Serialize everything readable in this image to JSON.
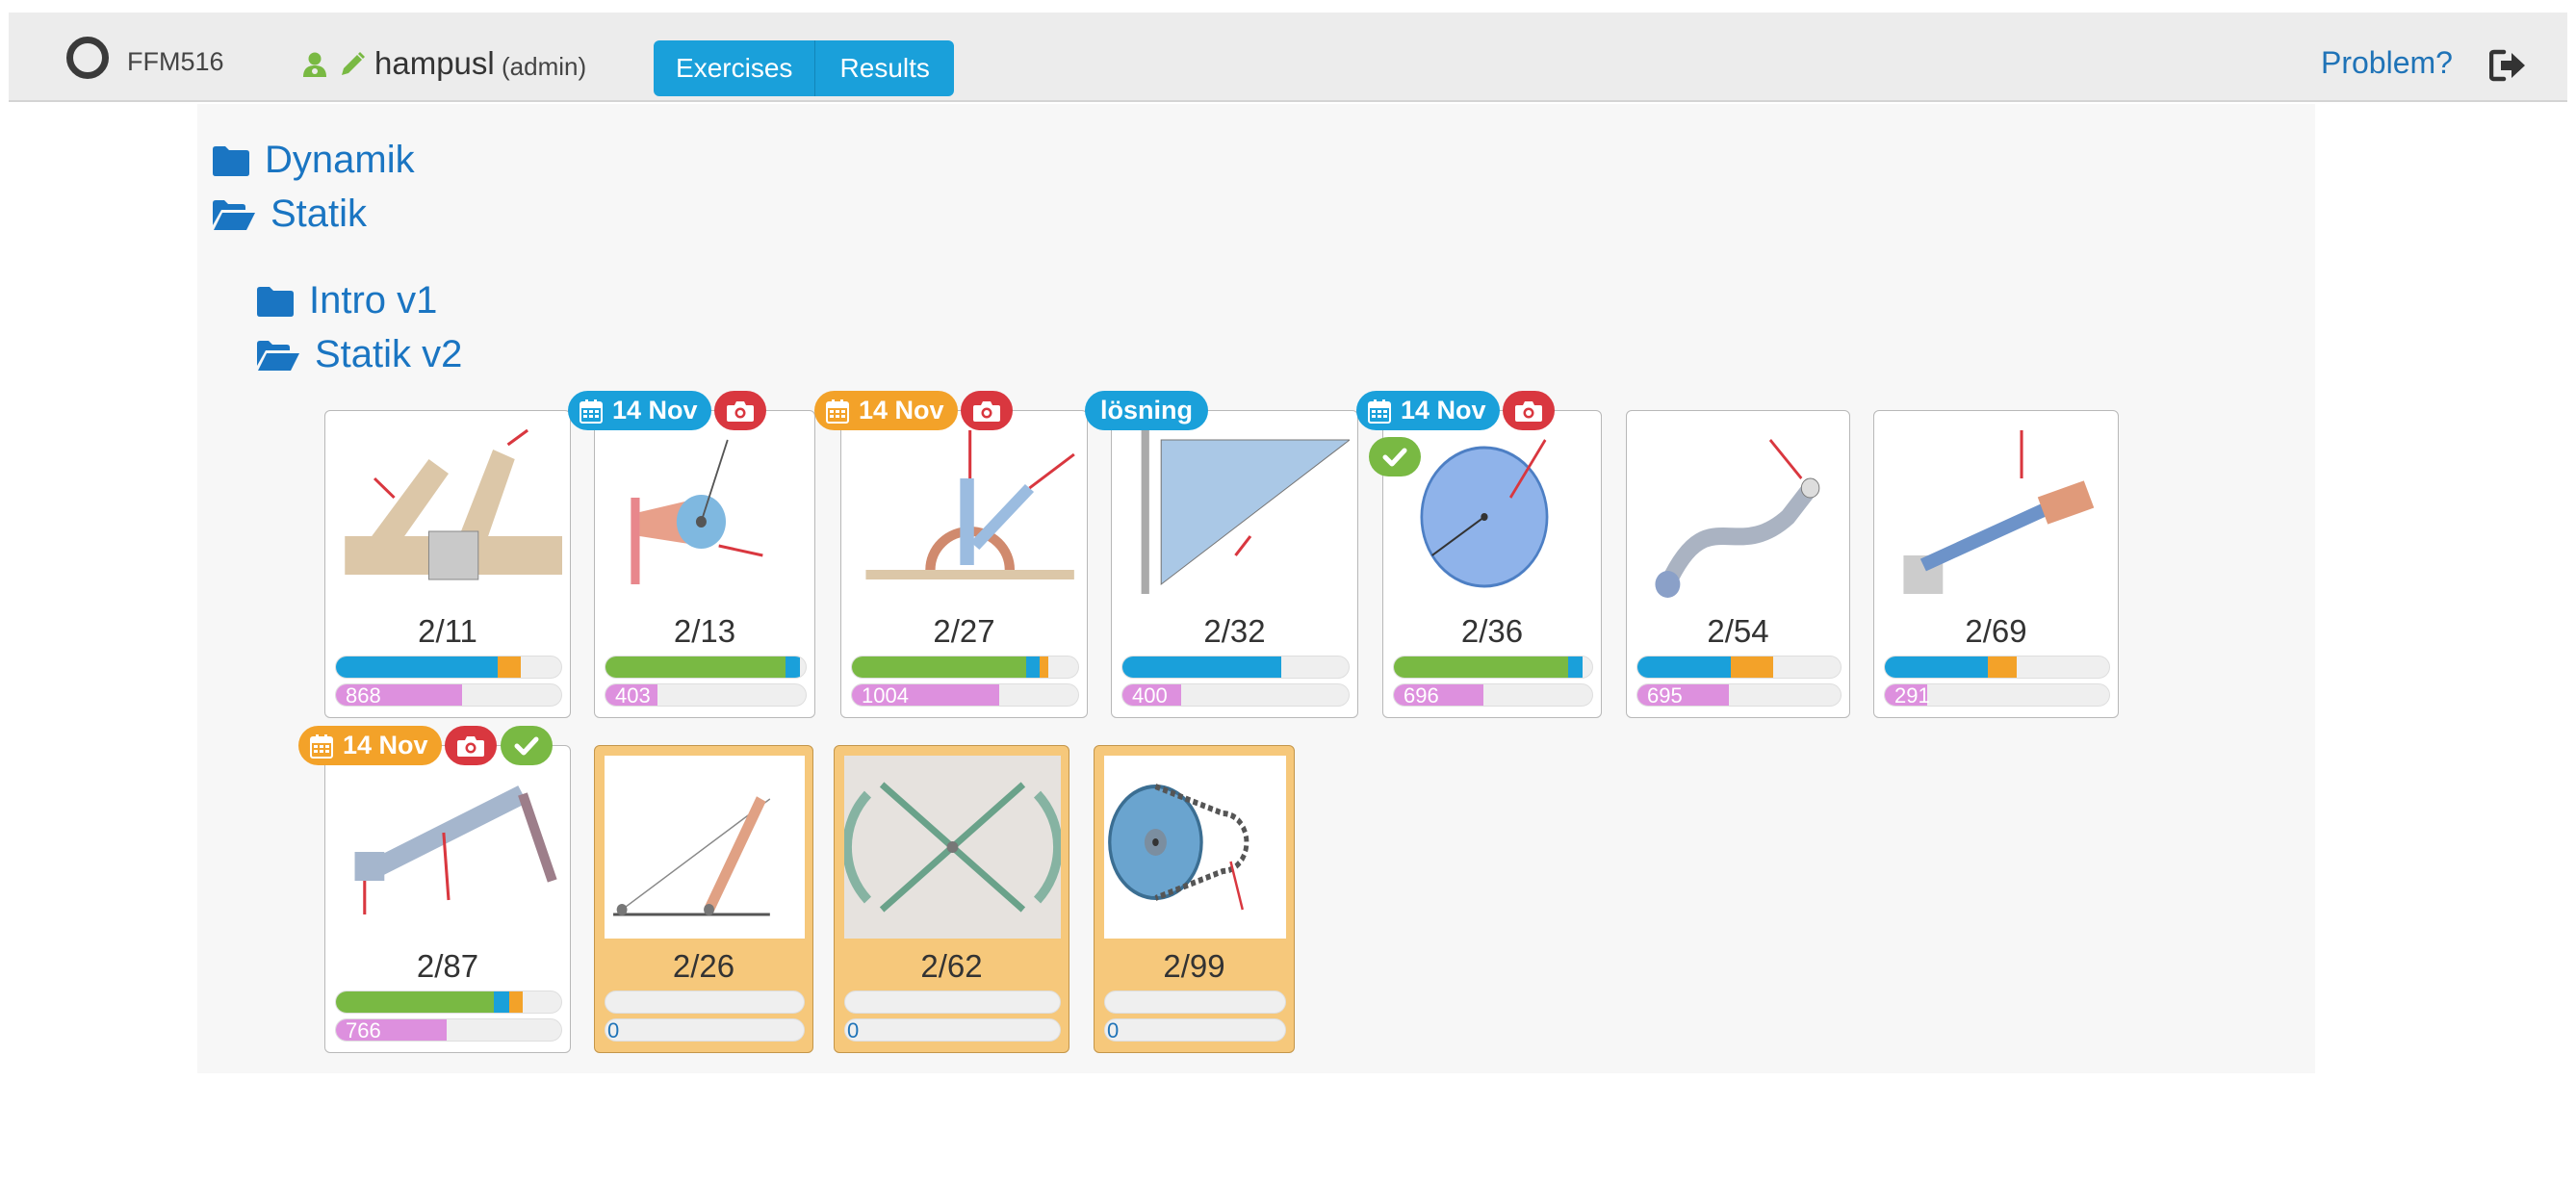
{
  "navbar": {
    "course": "FFM516",
    "username": "hampusl",
    "role": "(admin)",
    "tabs": {
      "exercises": "Exercises",
      "results": "Results"
    },
    "problem_link": "Problem?",
    "icons": [
      "user-icon",
      "pencil-icon",
      "sign-out-icon"
    ]
  },
  "folders": {
    "dynamik": "Dynamik",
    "statik": "Statik",
    "intro_v1": "Intro v1",
    "statik_v2": "Statik v2"
  },
  "colors": {
    "blue": "#1aa0da",
    "orange": "#f3a229",
    "green": "#79b943",
    "red": "#d9373f",
    "pink": "#dd90de",
    "link": "#1a75c2"
  },
  "exercises": [
    {
      "label": "2/11",
      "count": "868",
      "count_fraction": 0.56,
      "progress": [
        {
          "c": "blue",
          "f": 0.72
        },
        {
          "c": "orange",
          "f": 0.1
        }
      ],
      "date": null,
      "date_color": null,
      "camera": false,
      "check": false,
      "warn": false
    },
    {
      "label": "2/13",
      "count": "403",
      "count_fraction": 0.26,
      "progress": [
        {
          "c": "green",
          "f": 0.9
        },
        {
          "c": "blue",
          "f": 0.07
        }
      ],
      "date": "14 Nov",
      "date_color": "blue",
      "camera": true,
      "check": false,
      "warn": false
    },
    {
      "label": "2/27",
      "count": "1004",
      "count_fraction": 0.65,
      "progress": [
        {
          "c": "green",
          "f": 0.77
        },
        {
          "c": "blue",
          "f": 0.06
        },
        {
          "c": "orange",
          "f": 0.04
        }
      ],
      "date": "14 Nov",
      "date_color": "orange",
      "camera": true,
      "check": false,
      "warn": false
    },
    {
      "label": "2/32",
      "count": "400",
      "count_fraction": 0.26,
      "progress": [
        {
          "c": "blue",
          "f": 0.7
        }
      ],
      "date": "lösning",
      "date_color": "blue",
      "camera": false,
      "check": false,
      "warn": false
    },
    {
      "label": "2/36",
      "count": "696",
      "count_fraction": 0.45,
      "progress": [
        {
          "c": "green",
          "f": 0.88
        },
        {
          "c": "blue",
          "f": 0.07
        }
      ],
      "date": "14 Nov",
      "date_color": "blue",
      "camera": true,
      "check": true,
      "warn": false
    },
    {
      "label": "2/54",
      "count": "695",
      "count_fraction": 0.45,
      "progress": [
        {
          "c": "blue",
          "f": 0.46
        },
        {
          "c": "orange",
          "f": 0.21
        }
      ],
      "date": null,
      "date_color": null,
      "camera": false,
      "check": false,
      "warn": false
    },
    {
      "label": "2/69",
      "count": "291",
      "count_fraction": 0.19,
      "progress": [
        {
          "c": "blue",
          "f": 0.46
        },
        {
          "c": "orange",
          "f": 0.13
        }
      ],
      "date": null,
      "date_color": null,
      "camera": false,
      "check": false,
      "warn": false
    },
    {
      "label": "2/87",
      "count": "766",
      "count_fraction": 0.49,
      "progress": [
        {
          "c": "green",
          "f": 0.7
        },
        {
          "c": "blue",
          "f": 0.07
        },
        {
          "c": "orange",
          "f": 0.06
        }
      ],
      "date": "14 Nov",
      "date_color": "orange",
      "camera": true,
      "check": true,
      "warn": false
    },
    {
      "label": "2/26",
      "count": "0",
      "count_fraction": 0,
      "progress": [],
      "date": null,
      "date_color": null,
      "camera": false,
      "check": false,
      "warn": true
    },
    {
      "label": "2/62",
      "count": "0",
      "count_fraction": 0,
      "progress": [],
      "date": null,
      "date_color": null,
      "camera": false,
      "check": false,
      "warn": true
    },
    {
      "label": "2/99",
      "count": "0",
      "count_fraction": 0,
      "progress": [],
      "date": null,
      "date_color": null,
      "camera": false,
      "check": false,
      "warn": true
    }
  ]
}
